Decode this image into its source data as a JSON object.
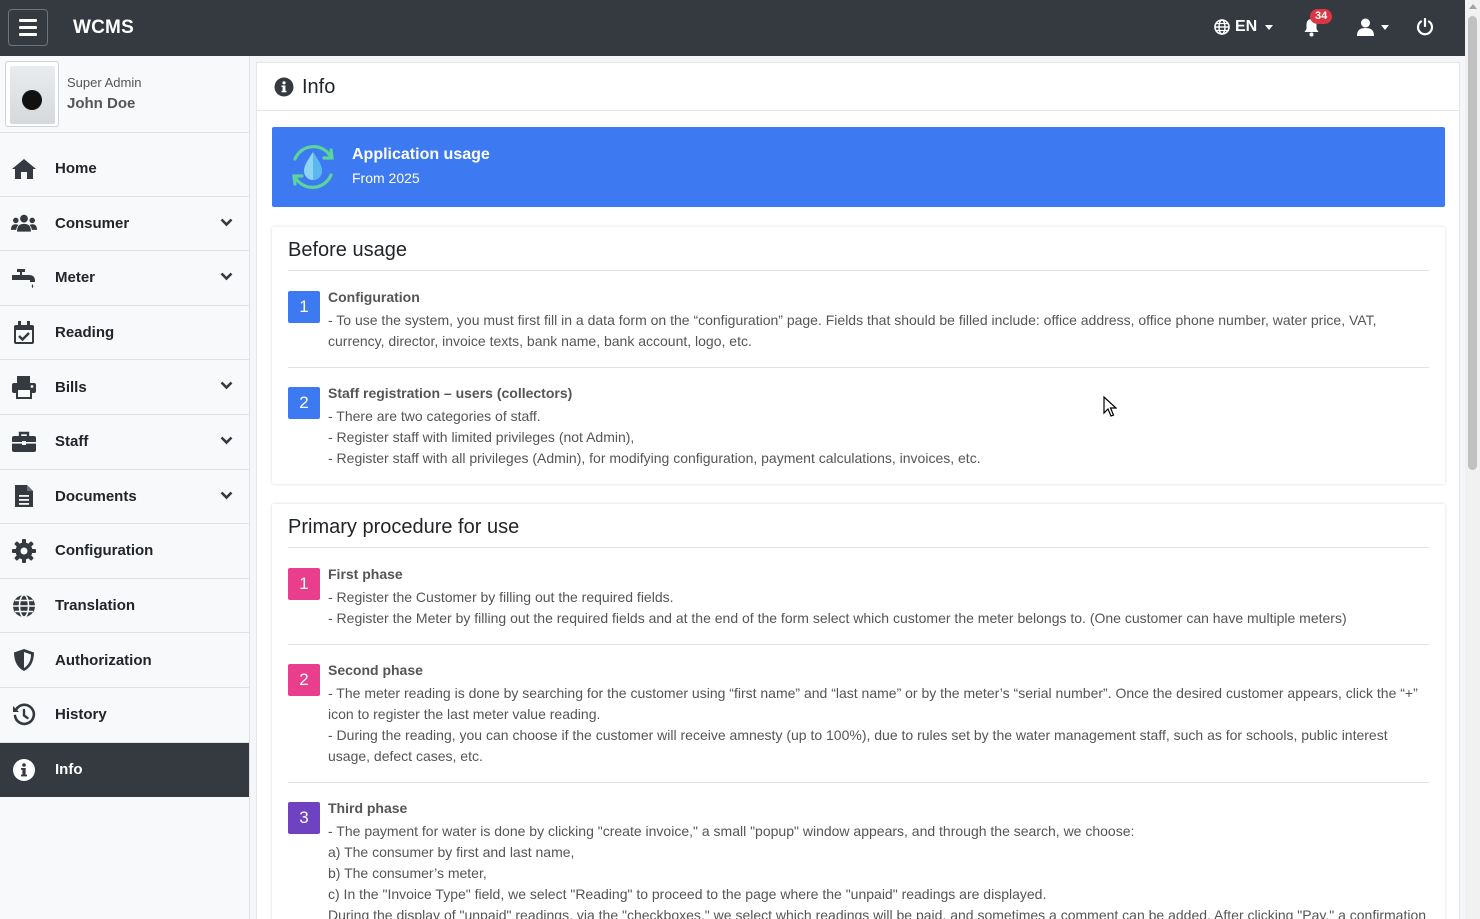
{
  "header": {
    "brand": "WCMS",
    "language": "EN",
    "notifications_count": "34"
  },
  "user": {
    "role": "Super Admin",
    "name": "John Doe"
  },
  "sidebar": {
    "items": [
      {
        "label": "Home",
        "icon": "home-icon",
        "expandable": false
      },
      {
        "label": "Consumer",
        "icon": "users-icon",
        "expandable": true
      },
      {
        "label": "Meter",
        "icon": "faucet-icon",
        "expandable": true
      },
      {
        "label": "Reading",
        "icon": "calendar-check-icon",
        "expandable": false
      },
      {
        "label": "Bills",
        "icon": "printer-icon",
        "expandable": true
      },
      {
        "label": "Staff",
        "icon": "briefcase-icon",
        "expandable": true
      },
      {
        "label": "Documents",
        "icon": "file-icon",
        "expandable": true
      },
      {
        "label": "Configuration",
        "icon": "gear-icon",
        "expandable": false
      },
      {
        "label": "Translation",
        "icon": "globe-icon",
        "expandable": false
      },
      {
        "label": "Authorization",
        "icon": "shield-icon",
        "expandable": false
      },
      {
        "label": "History",
        "icon": "history-icon",
        "expandable": false
      },
      {
        "label": "Info",
        "icon": "info-icon",
        "expandable": false,
        "active": true
      }
    ]
  },
  "page": {
    "title": "Info"
  },
  "banner": {
    "title": "Application usage",
    "subtitle": "From 2025"
  },
  "before_usage": {
    "heading": "Before usage",
    "steps": [
      {
        "number": "1",
        "title": "Configuration",
        "lines": [
          "- To use the system, you must first fill in a data form on the “configuration” page. Fields that should be filled include: office address, office phone number, water price, VAT, currency, director, invoice texts, bank name, bank account, logo, etc."
        ]
      },
      {
        "number": "2",
        "title": "Staff registration – users (collectors)",
        "lines": [
          "- There are two categories of staff.",
          "- Register staff with limited privileges (not Admin),",
          "- Register staff with all privileges (Admin), for modifying configuration, payment calculations, invoices, etc."
        ]
      }
    ]
  },
  "primary_procedure": {
    "heading": "Primary procedure for use",
    "steps": [
      {
        "number": "1",
        "title": "First phase",
        "lines": [
          "- Register the Customer by filling out the required fields.",
          "- Register the Meter by filling out the required fields and at the end of the form select which customer the meter belongs to. (One customer can have multiple meters)"
        ]
      },
      {
        "number": "2",
        "title": "Second phase",
        "lines": [
          "- The meter reading is done by searching for the customer using “first name” and “last name” or by the meter’s “serial number”. Once the desired customer appears, click the “+” icon to register the last meter value reading.",
          "- During the reading, you can choose if the customer will receive amnesty (up to 100%), due to rules set by the water management staff, such as for schools, public interest usage, defect cases, etc."
        ]
      },
      {
        "number": "3",
        "title": "Third phase",
        "lines": [
          "- The payment for water is done by clicking \"create invoice,\" a small \"popup\" window appears, and through the search, we choose:",
          "a) The consumer by first and last name,",
          "b) The consumer’s meter,",
          "c) In the \"Invoice Type\" field, we select \"Reading\" to proceed to the page where the \"unpaid\" readings are displayed.",
          "During the display of \"unpaid\" readings, via the \"checkboxes,\" we select which readings will be paid, and sometimes a comment can be added. After clicking \"Pay,\" a confirmation"
        ]
      }
    ]
  },
  "colors": {
    "navbar": "#343a40",
    "accent_blue": "#3d7af2",
    "pink": "#e83e8c",
    "purple": "#6f42c1",
    "badge_red": "#dc3545"
  }
}
